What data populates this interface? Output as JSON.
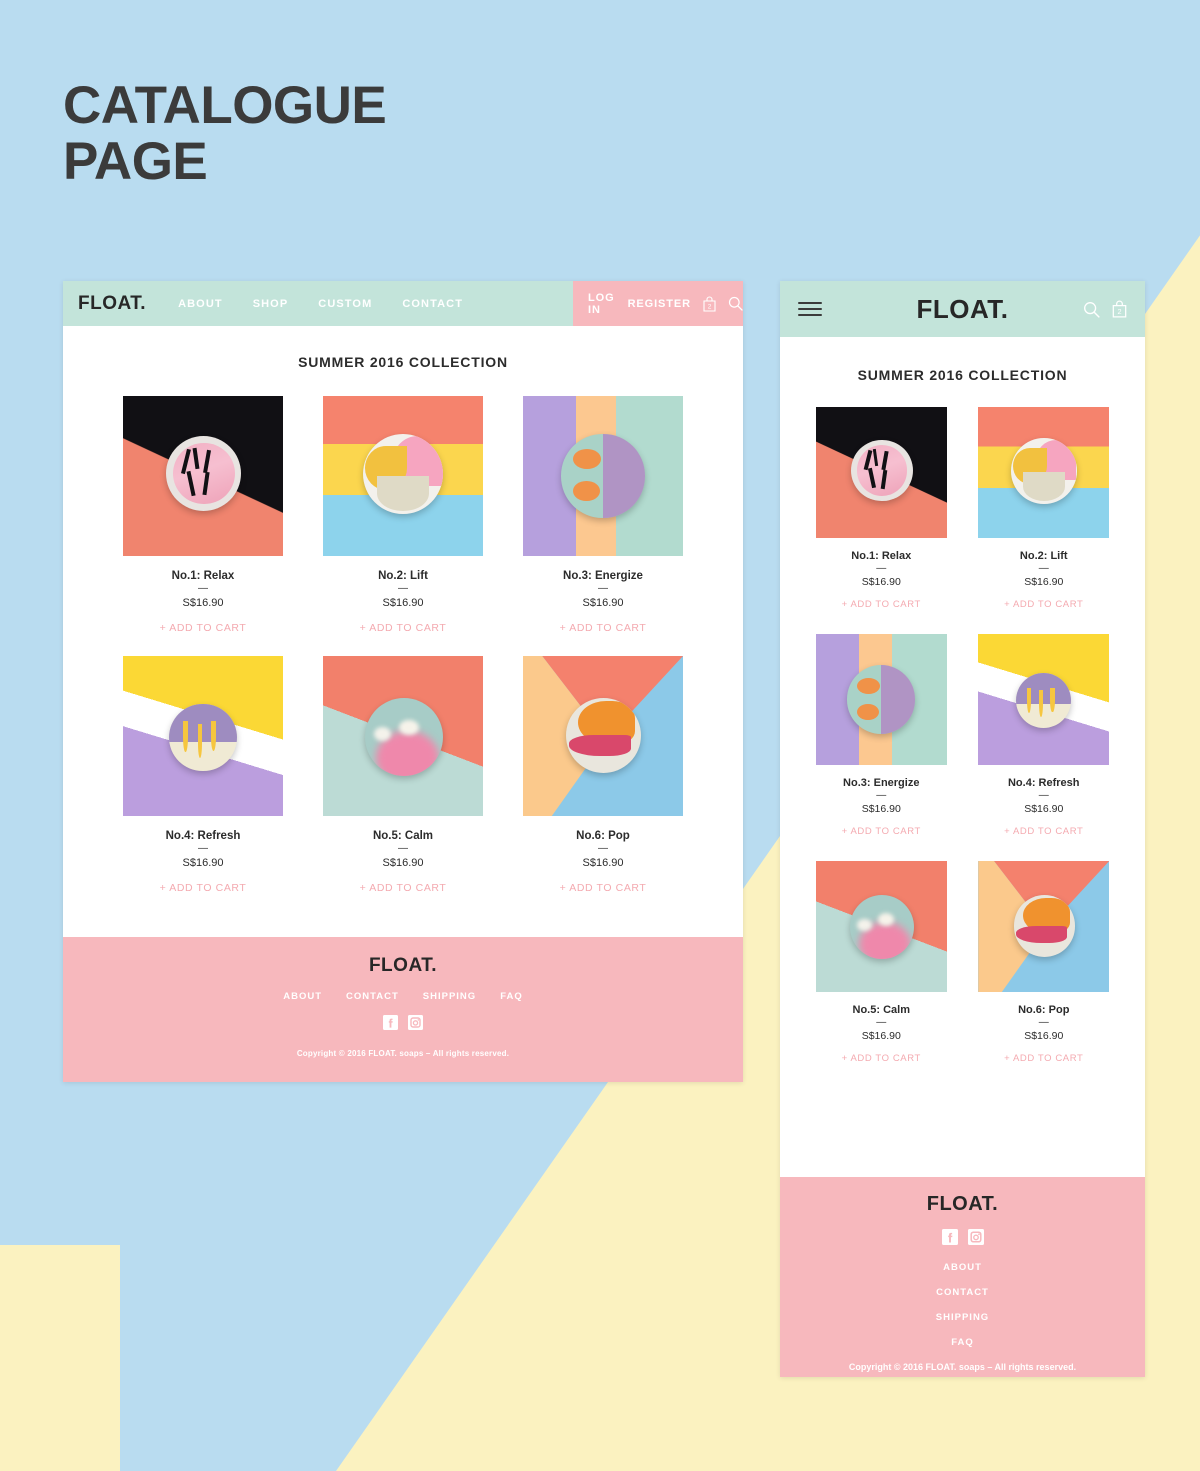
{
  "page": {
    "heading_line1": "CATALOGUE",
    "heading_line2": "PAGE",
    "bg_blue": "#b9dcf0",
    "bg_cream": "#fbf2c0",
    "accent_mint": "#c3e4da",
    "accent_pink": "#f7b8bd",
    "text_dark": "#2c2c2c",
    "cart_link_color": "#f4aab0"
  },
  "brand": {
    "name": "FLOAT."
  },
  "desktop": {
    "nav": {
      "logo": "FLOAT.",
      "links": [
        {
          "label": "ABOUT"
        },
        {
          "label": "SHOP"
        },
        {
          "label": "CUSTOM"
        },
        {
          "label": "CONTACT"
        }
      ],
      "login_label": "LOG IN",
      "register_label": "REGISTER",
      "cart_icon": "shopping-bag-icon",
      "cart_count": "2",
      "search_icon": "search-icon"
    },
    "collection_title": "SUMMER 2016 COLLECTION",
    "footer": {
      "logo": "FLOAT.",
      "links": [
        {
          "label": "ABOUT"
        },
        {
          "label": "CONTACT"
        },
        {
          "label": "SHIPPING"
        },
        {
          "label": "FAQ"
        }
      ],
      "social": [
        {
          "name": "facebook-icon"
        },
        {
          "name": "instagram-icon"
        }
      ],
      "copyright": "Copyright © 2016 FLOAT. soaps – All rights reserved."
    }
  },
  "mobile": {
    "nav": {
      "menu_icon": "hamburger-menu-icon",
      "logo": "FLOAT.",
      "search_icon": "search-icon",
      "cart_icon": "shopping-bag-icon",
      "cart_count": "2"
    },
    "collection_title": "SUMMER 2016 COLLECTION",
    "footer": {
      "logo": "FLOAT.",
      "social": [
        {
          "name": "facebook-icon"
        },
        {
          "name": "instagram-icon"
        }
      ],
      "links": [
        {
          "label": "ABOUT"
        },
        {
          "label": "CONTACT"
        },
        {
          "label": "SHIPPING"
        },
        {
          "label": "FAQ"
        }
      ],
      "copyright": "Copyright © 2016 FLOAT. soaps – All rights reserved."
    }
  },
  "products": [
    {
      "id": "p1",
      "name": "No.1: Relax",
      "dash": "—",
      "price": "S$16.90",
      "cta": "+ ADD TO CART"
    },
    {
      "id": "p2",
      "name": "No.2: Lift",
      "dash": "—",
      "price": "S$16.90",
      "cta": "+ ADD TO CART"
    },
    {
      "id": "p3",
      "name": "No.3: Energize",
      "dash": "—",
      "price": "S$16.90",
      "cta": "+ ADD TO CART"
    },
    {
      "id": "p4",
      "name": "No.4: Refresh",
      "dash": "—",
      "price": "S$16.90",
      "cta": "+ ADD TO CART"
    },
    {
      "id": "p5",
      "name": "No.5: Calm",
      "dash": "—",
      "price": "S$16.90",
      "cta": "+ ADD TO CART"
    },
    {
      "id": "p6",
      "name": "No.6: Pop",
      "dash": "—",
      "price": "S$16.90",
      "cta": "+ ADD TO CART"
    }
  ]
}
